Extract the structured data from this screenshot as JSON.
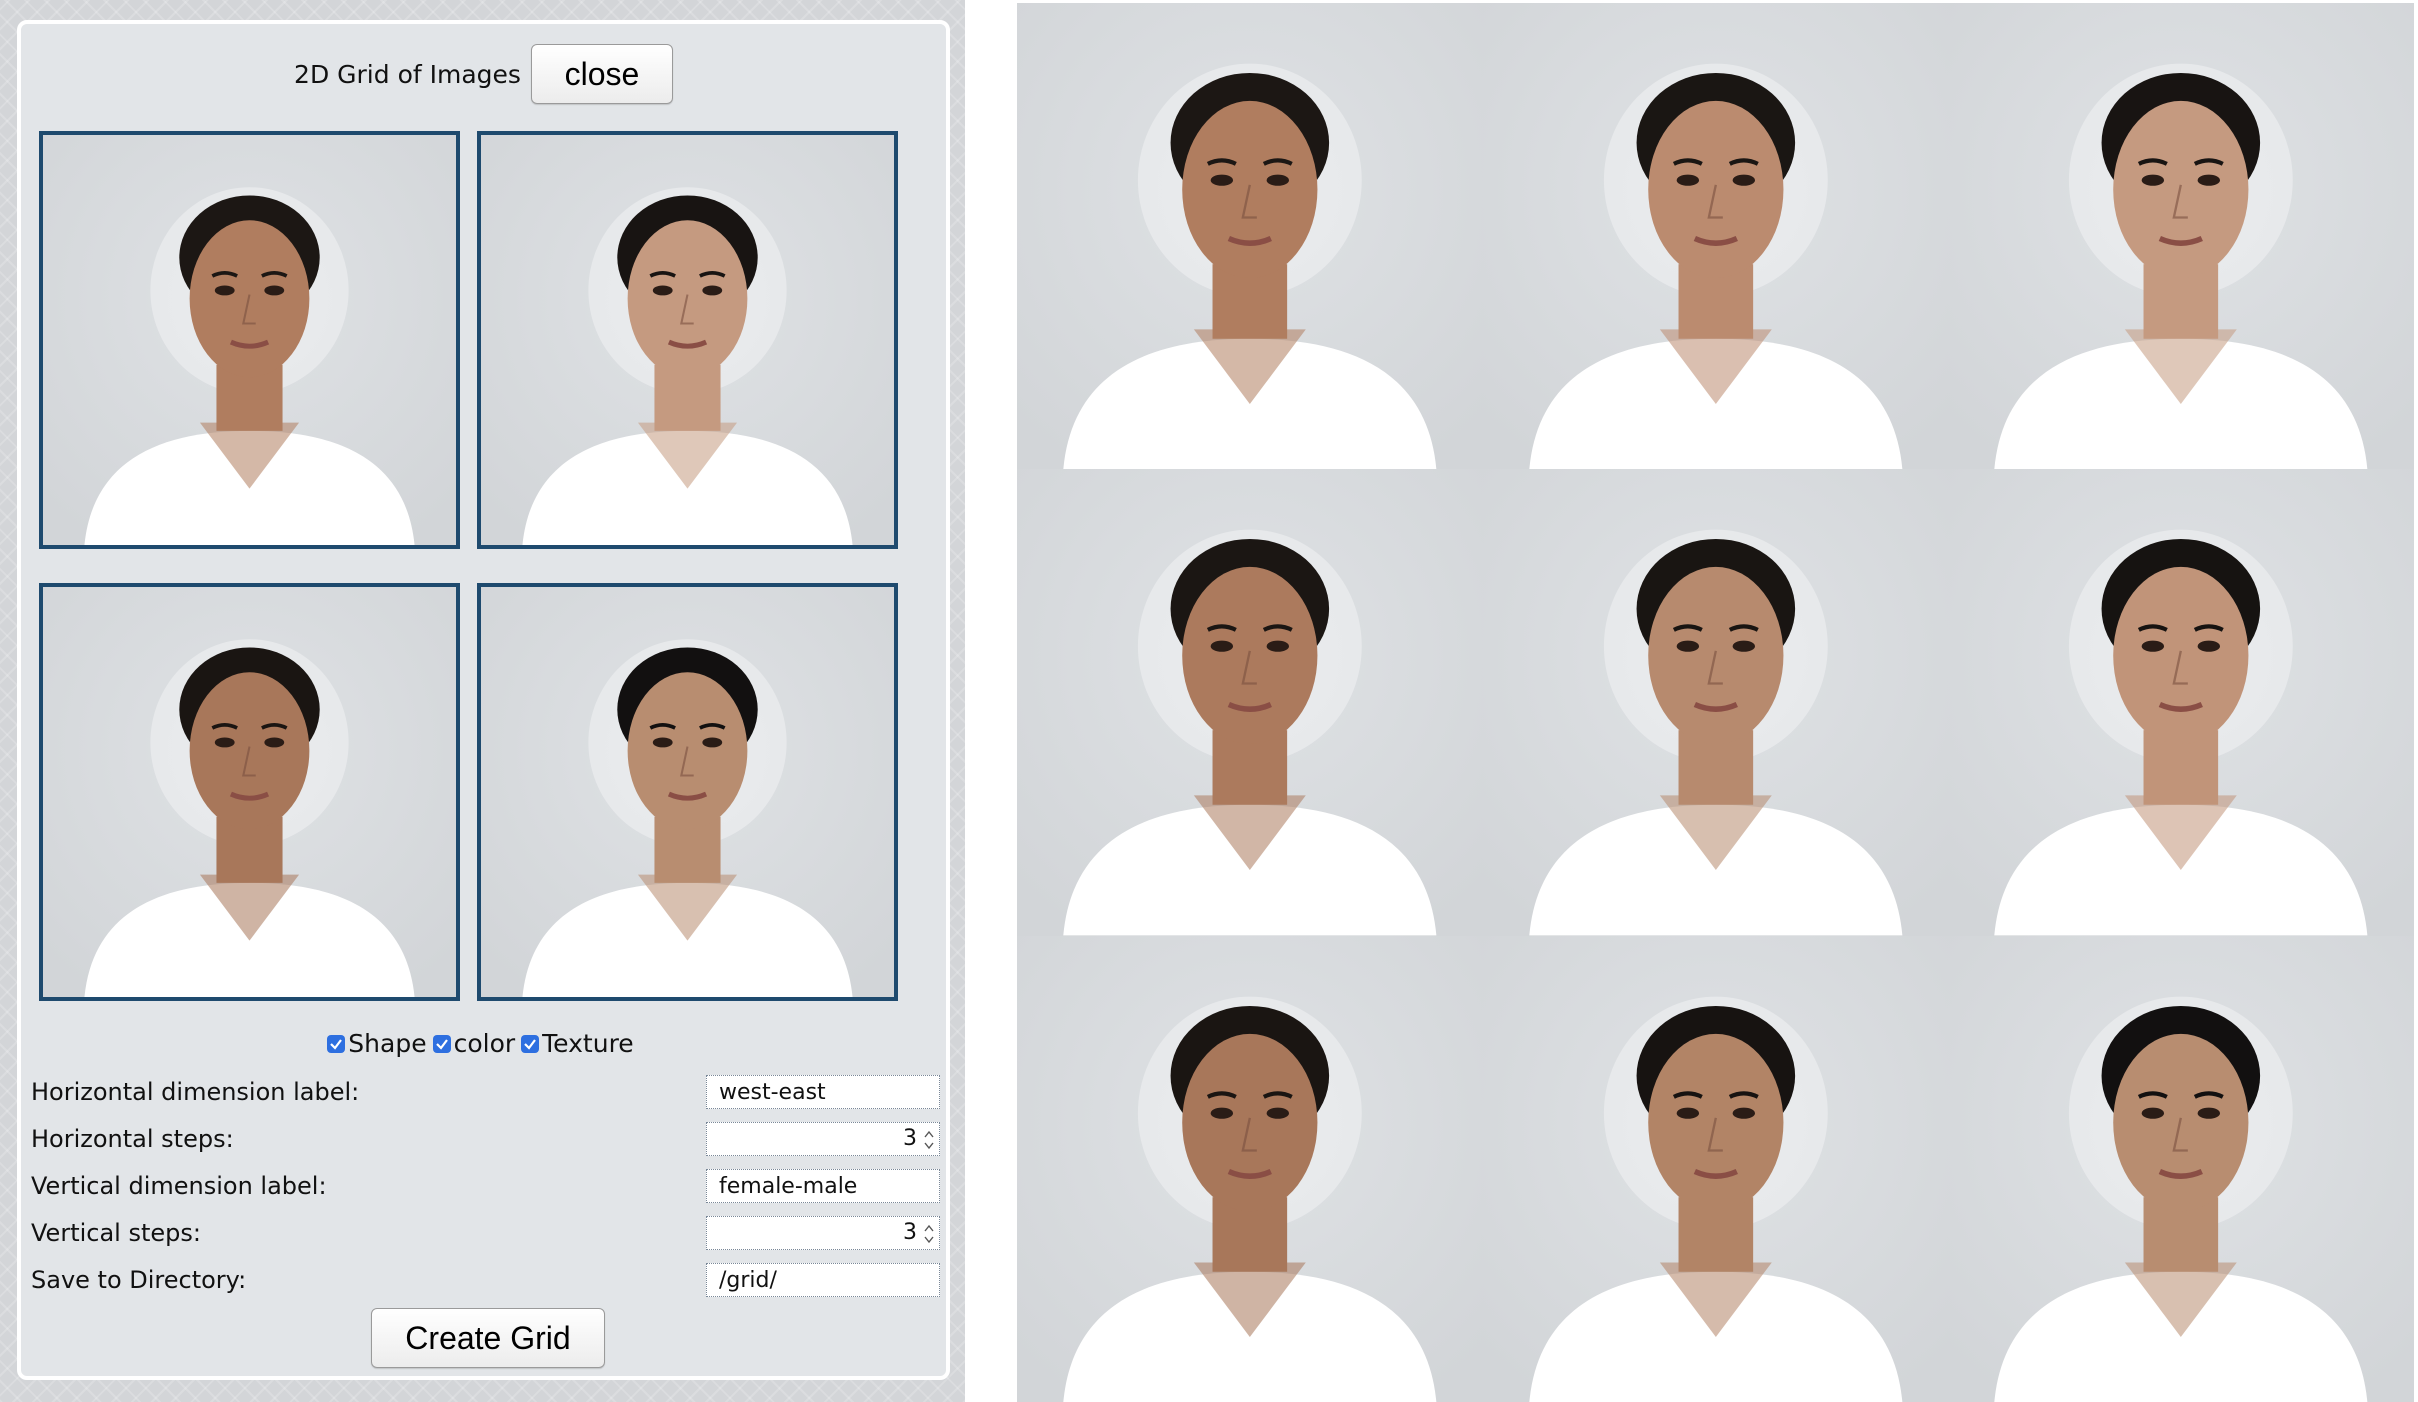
{
  "dialog": {
    "title": "2D Grid of Images",
    "close_label": "close",
    "thumbnails": [
      {
        "position": "top-left",
        "description": "female",
        "skin": "#b07d5f",
        "hair": "#1c1714",
        "shirt": "#ffffff"
      },
      {
        "position": "top-right",
        "description": "female",
        "skin": "#c59a80",
        "hair": "#181412",
        "shirt": "#ffffff"
      },
      {
        "position": "bottom-left",
        "description": "male",
        "skin": "#a8775a",
        "hair": "#1a1512",
        "shirt": "#ffffff"
      },
      {
        "position": "bottom-right",
        "description": "male",
        "skin": "#b88d70",
        "hair": "#121010",
        "shirt": "#ffffff"
      }
    ],
    "options": [
      {
        "label": "Shape",
        "checked": true
      },
      {
        "label": "color",
        "checked": true
      },
      {
        "label": "Texture",
        "checked": true
      }
    ],
    "fields": {
      "h_label": {
        "label": "Horizontal dimension label:",
        "value": "west-east"
      },
      "h_steps": {
        "label": "Horizontal steps:",
        "value": "3"
      },
      "v_label": {
        "label": "Vertical dimension label:",
        "value": "female-male"
      },
      "v_steps": {
        "label": "Vertical steps:",
        "value": "3"
      },
      "directory": {
        "label": "Save to Directory:",
        "value": "/grid/"
      }
    },
    "create_label": "Create Grid"
  },
  "grid": {
    "rows": 3,
    "cols": 3,
    "cells": [
      {
        "skin": "#b07d5f",
        "hair": "#1c1714"
      },
      {
        "skin": "#bb8b6f",
        "hair": "#1a1613"
      },
      {
        "skin": "#c59a80",
        "hair": "#181412"
      },
      {
        "skin": "#ac7a5d",
        "hair": "#1b1613"
      },
      {
        "skin": "#b78a6e",
        "hair": "#191512"
      },
      {
        "skin": "#c19479",
        "hair": "#161311"
      },
      {
        "skin": "#a8775a",
        "hair": "#1a1512"
      },
      {
        "skin": "#b28466",
        "hair": "#171311"
      },
      {
        "skin": "#b88d70",
        "hair": "#121010"
      }
    ]
  },
  "colors": {
    "thumb_border": "#1e4a6e",
    "checkbox": "#2d6fe0",
    "background_photo": "#d2d5d8"
  }
}
